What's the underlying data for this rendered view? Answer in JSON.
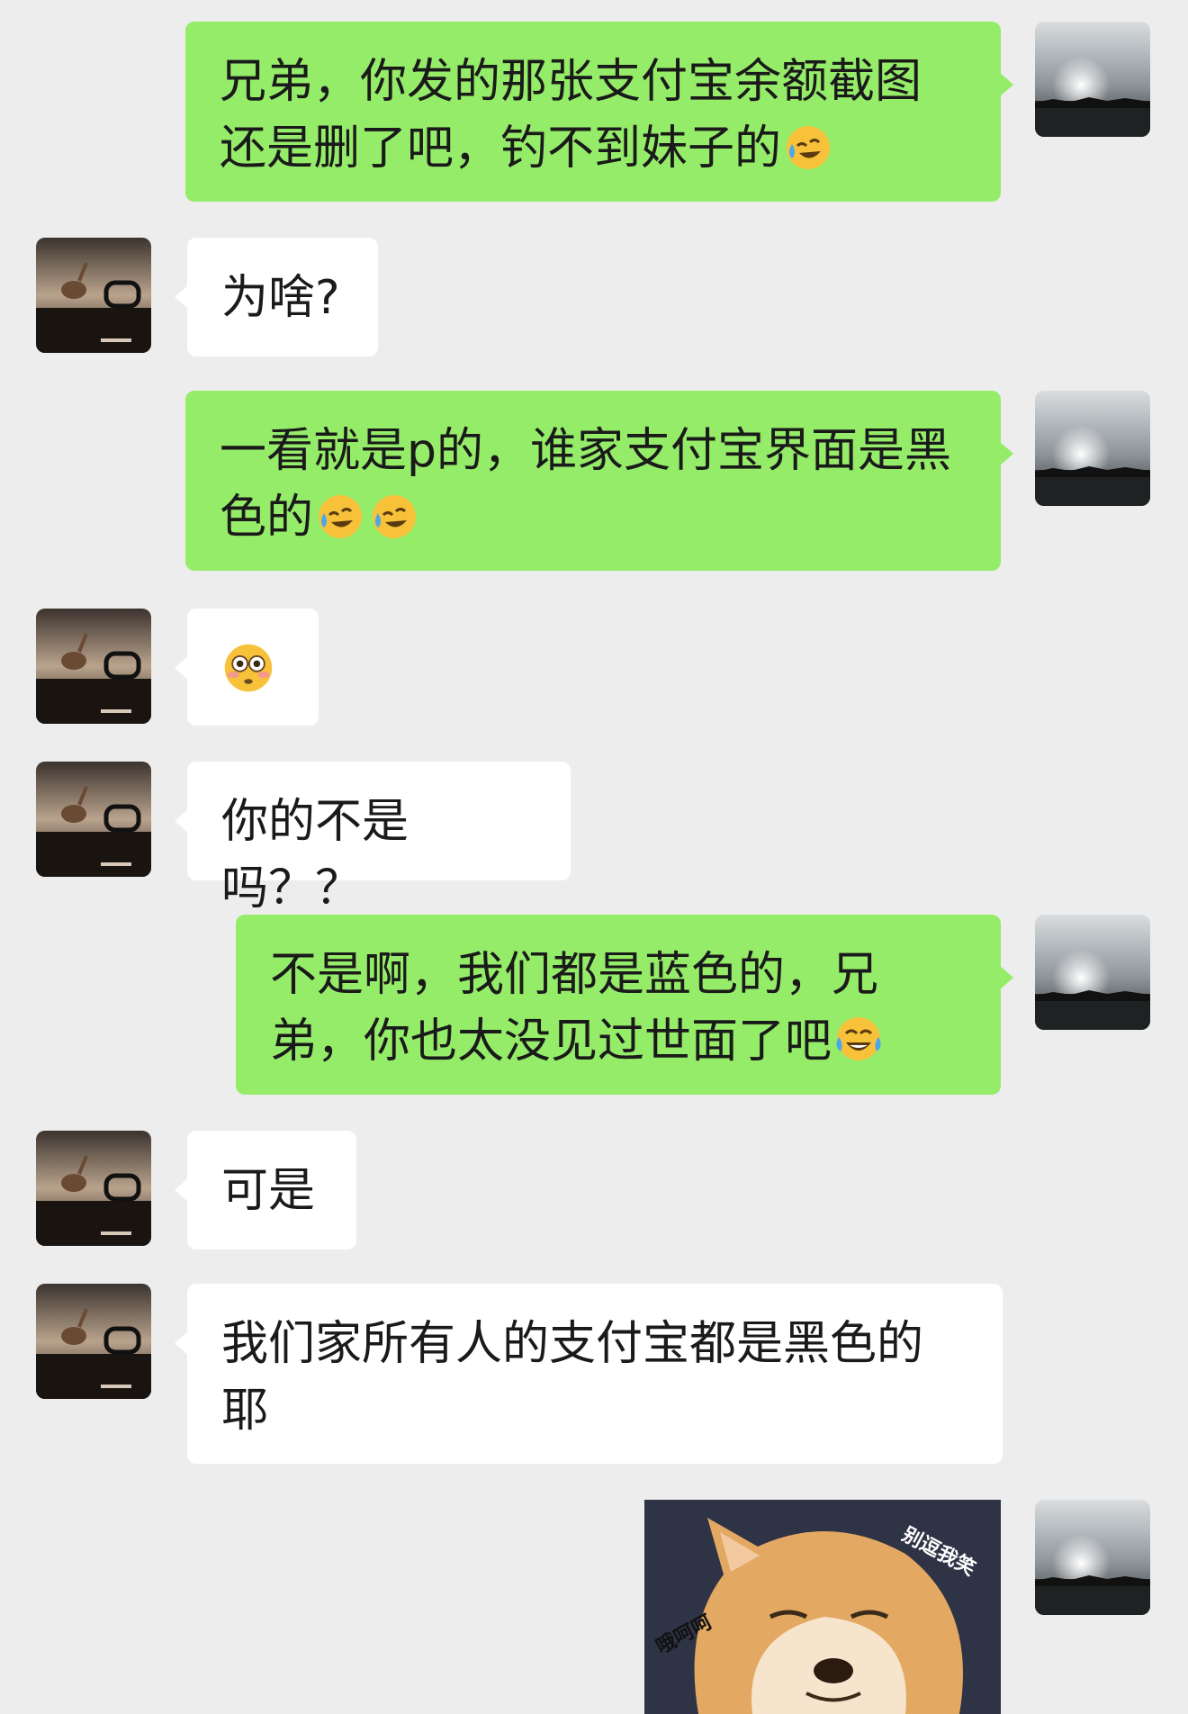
{
  "messages": [
    {
      "side": "me",
      "text": "兄弟，你发的那张支付宝余额截图还是删了吧，钓不到妹子的",
      "emoji": [
        "crying-laughing-emoji"
      ]
    },
    {
      "side": "other",
      "text": "为啥?"
    },
    {
      "side": "me",
      "text": "一看就是p的，谁家支付宝界面是黑色的",
      "emoji": [
        "crying-laughing-emoji",
        "crying-laughing-emoji"
      ]
    },
    {
      "side": "other",
      "text": "",
      "emoji": [
        "flushed-emoji"
      ]
    },
    {
      "side": "other",
      "text": "你的不是吗？？"
    },
    {
      "side": "me",
      "text": "不是啊，我们都是蓝色的，兄弟，你也太没见过世面了吧",
      "emoji": [
        "tears-of-joy-emoji"
      ]
    },
    {
      "side": "other",
      "text": "可是"
    },
    {
      "side": "other",
      "text": "我们家所有人的支付宝都是黑色的耶"
    },
    {
      "side": "me",
      "type": "sticker",
      "icon": "shiba-dog-sticker",
      "captions": [
        "别逗我笑",
        "哦呵呵"
      ]
    }
  ],
  "colors": {
    "background": "#ededed",
    "my_bubble": "#95ec69",
    "other_bubble": "#ffffff"
  }
}
